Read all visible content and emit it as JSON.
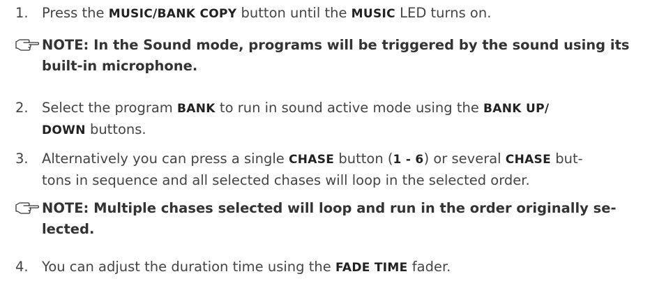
{
  "steps": [
    {
      "number": "1.",
      "parts": [
        {
          "t": "Press the "
        },
        {
          "t": "MUSIC/BANK COPY",
          "k": true
        },
        {
          "t": " button until the "
        },
        {
          "t": "MUSIC",
          "k": true
        },
        {
          "t": " LED turns on."
        }
      ]
    },
    {
      "number": "2.",
      "parts": [
        {
          "t": "Select the program "
        },
        {
          "t": "BANK",
          "k": true
        },
        {
          "t": " to run in sound active mode using the "
        },
        {
          "t": "BANK UP/",
          "k": true
        },
        {
          "br": true
        },
        {
          "t": "DOWN",
          "k": true
        },
        {
          "t": " buttons."
        }
      ]
    },
    {
      "number": "3.",
      "parts": [
        {
          "t": "Alternatively you can press a single "
        },
        {
          "t": "CHASE",
          "k": true
        },
        {
          "t": " button ("
        },
        {
          "t": "1 - 6",
          "k": true
        },
        {
          "t": ") or several "
        },
        {
          "t": "CHASE",
          "k": true
        },
        {
          "t": " but-"
        },
        {
          "br": true
        },
        {
          "t": "tons in sequence and all selected chases will loop in the selected order."
        }
      ]
    },
    {
      "number": "4.",
      "parts": [
        {
          "t": "You can adjust the duration time using the "
        },
        {
          "t": "FADE TIME",
          "k": true
        },
        {
          "t": " fader."
        }
      ]
    }
  ],
  "notes": [
    {
      "icon": "pointing-hand-icon",
      "lines": [
        "NOTE: In the Sound mode, programs will be triggered by the sound using its",
        "built-in microphone."
      ]
    },
    {
      "icon": "pointing-hand-icon",
      "lines": [
        "NOTE: Multiple chases selected will loop and run in the order originally se-",
        "lected."
      ]
    }
  ]
}
